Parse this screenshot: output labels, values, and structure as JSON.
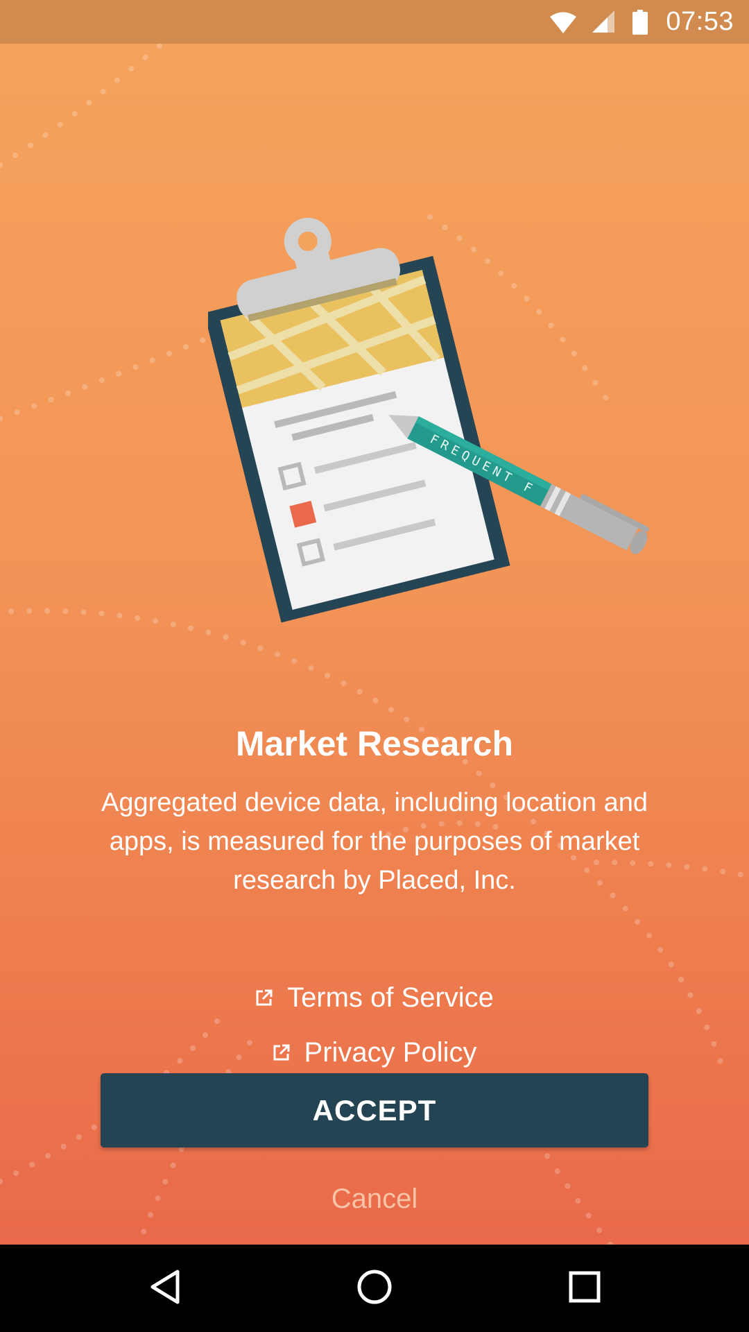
{
  "status_bar": {
    "time": "07:53",
    "icons": [
      "wifi-icon",
      "signal-icon",
      "battery-icon"
    ]
  },
  "illustration": {
    "pen_text": "FREQUENT F"
  },
  "main": {
    "title": "Market Research",
    "description": "Aggregated device data, including location and apps, is measured for the purposes of market research by Placed, Inc.",
    "links": [
      {
        "label": "Terms of Service",
        "icon": "external-link-icon"
      },
      {
        "label": "Privacy Policy",
        "icon": "external-link-icon"
      }
    ],
    "accept_label": "ACCEPT",
    "cancel_label": "Cancel"
  },
  "nav_bar": {
    "buttons": [
      "back-icon",
      "home-icon",
      "recents-icon"
    ]
  },
  "colors": {
    "status_bar": "#d18b4e",
    "gradient_top": "#f5a25c",
    "gradient_bottom": "#e9694a",
    "accept_button": "#244453",
    "cancel_text": "#f7c4a8"
  }
}
